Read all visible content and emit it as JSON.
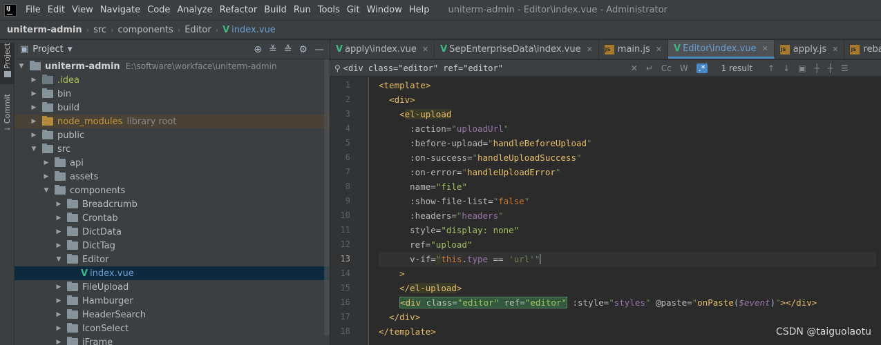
{
  "menu": {
    "items": [
      "File",
      "Edit",
      "View",
      "Navigate",
      "Code",
      "Analyze",
      "Refactor",
      "Build",
      "Run",
      "Tools",
      "Git",
      "Window",
      "Help"
    ],
    "window_title": "uniterm-admin - Editor\\index.vue - Administrator"
  },
  "breadcrumb": [
    "uniterm-admin",
    "src",
    "components",
    "Editor",
    "index.vue"
  ],
  "stripe": {
    "project": "Project",
    "commit": "Commit"
  },
  "project_panel": {
    "title": "Project",
    "tree": [
      {
        "label": "uniterm-admin",
        "extra": "E:\\software\\workface\\uniterm-admin"
      },
      {
        "label": ".idea"
      },
      {
        "label": "bin"
      },
      {
        "label": "build"
      },
      {
        "label": "node_modules",
        "extra": "library root"
      },
      {
        "label": "public"
      },
      {
        "label": "src"
      },
      {
        "label": "api"
      },
      {
        "label": "assets"
      },
      {
        "label": "components"
      },
      {
        "label": "Breadcrumb"
      },
      {
        "label": "Crontab"
      },
      {
        "label": "DictData"
      },
      {
        "label": "DictTag"
      },
      {
        "label": "Editor"
      },
      {
        "label": "index.vue"
      },
      {
        "label": "FileUpload"
      },
      {
        "label": "Hamburger"
      },
      {
        "label": "HeaderSearch"
      },
      {
        "label": "IconSelect"
      },
      {
        "label": "iFrame"
      }
    ]
  },
  "tabs": [
    "apply\\index.vue",
    "SepEnterpriseData\\index.vue",
    "main.js",
    "Editor\\index.vue",
    "apply.js",
    "rebate.js"
  ],
  "search": {
    "query": "<div class=\"editor\" ref=\"editor\"",
    "result": "1 result",
    "cc_label": "Cc",
    "w_label": "W",
    "regex_label": ".*"
  },
  "editor": {
    "line_numbers": [
      "1",
      "2",
      "3",
      "4",
      "5",
      "6",
      "7",
      "8",
      "9",
      "10",
      "11",
      "12",
      "13",
      "14",
      "15",
      "16",
      "17",
      "18"
    ],
    "current_line": 13
  },
  "watermark": "CSDN @taiguolaotu"
}
